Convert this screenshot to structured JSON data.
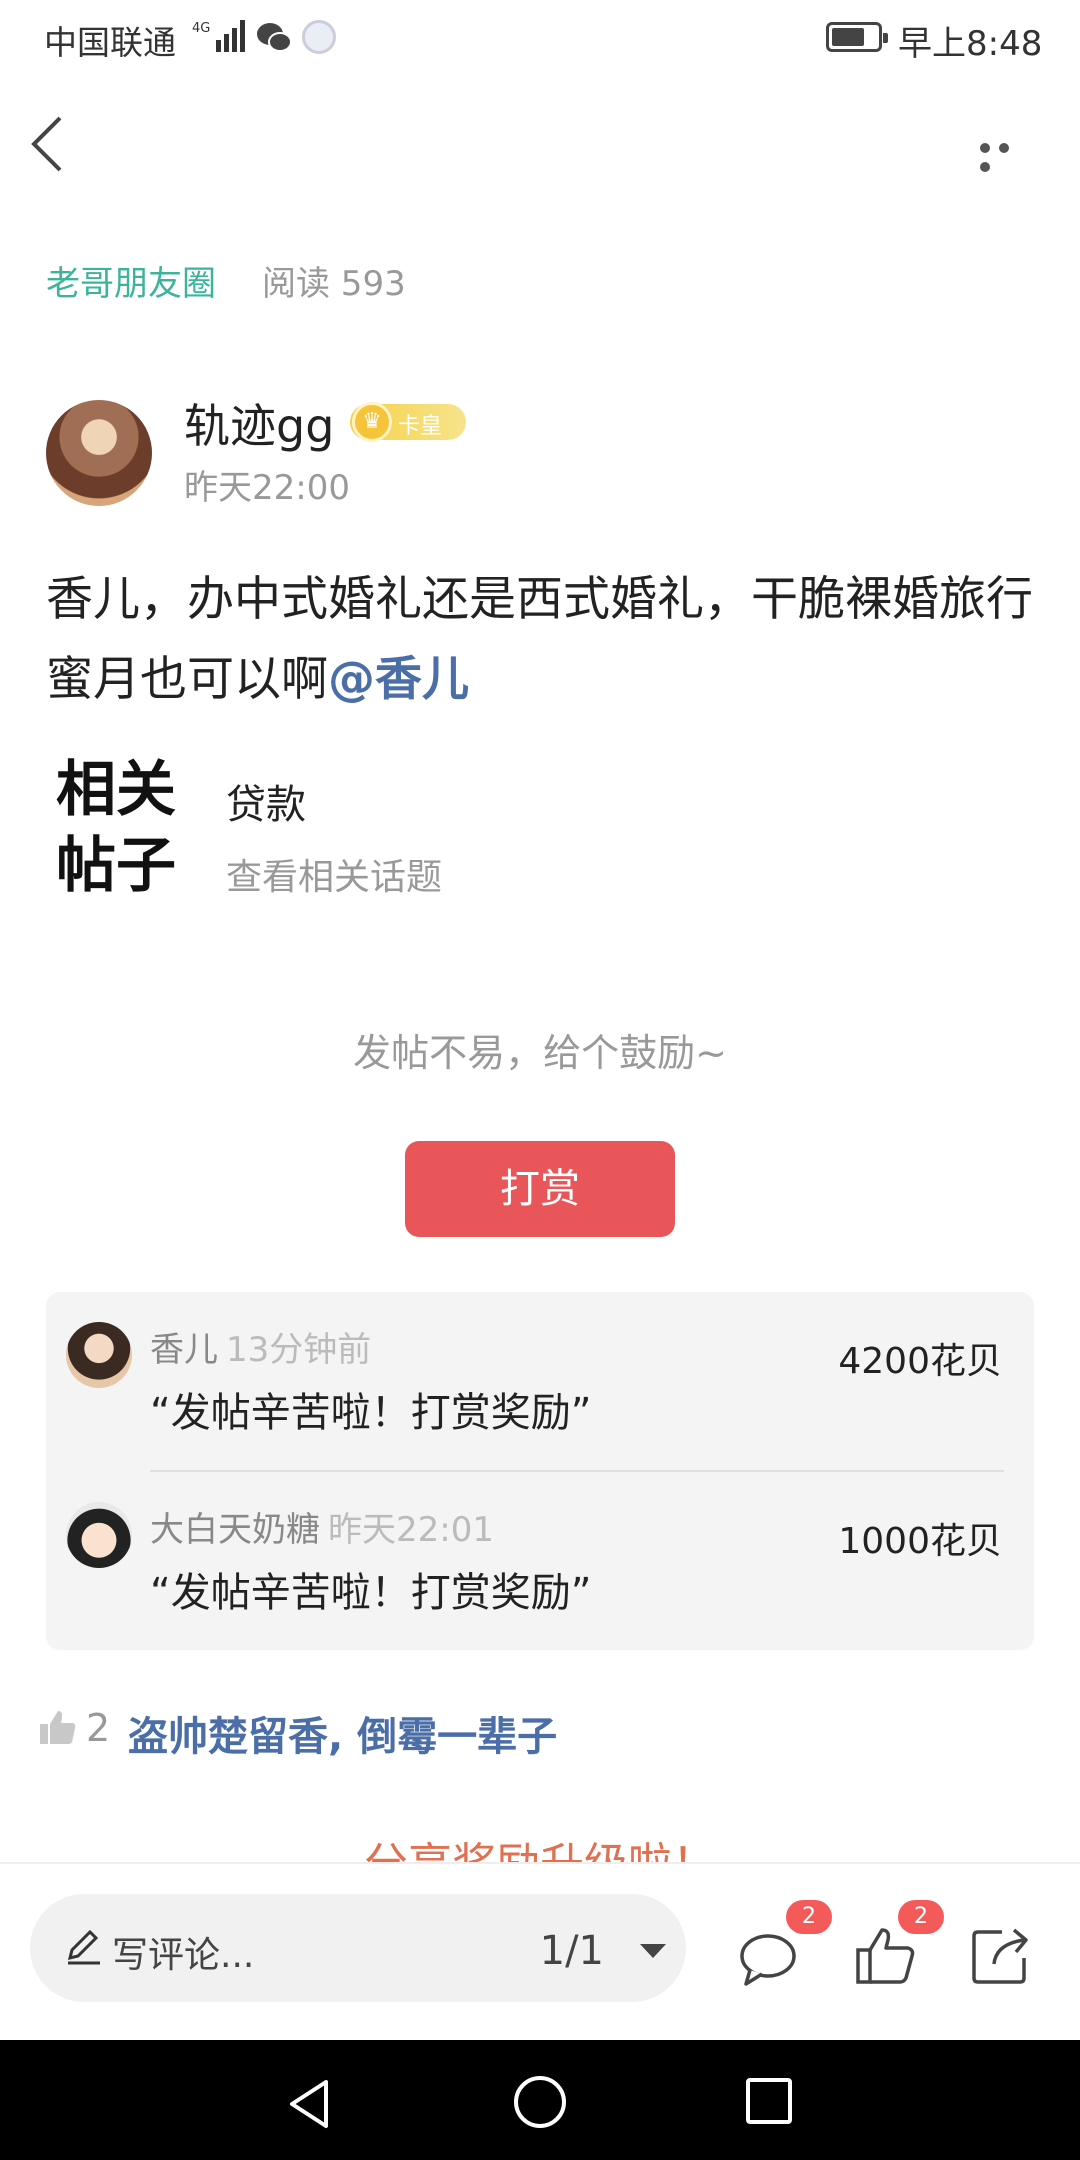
{
  "status_bar": {
    "carrier": "中国联通",
    "network": "4G",
    "time": "早上8:48"
  },
  "post": {
    "circle": "老哥朋友圈",
    "reads": "阅读 593",
    "author": "轨迹gg",
    "badge": "卡皇",
    "time": "昨天22:00",
    "content": "香儿，办中式婚礼还是西式婚礼，干脆裸婚旅行蜜月也可以啊",
    "mention": "@香儿"
  },
  "related": {
    "logo_line1": "相关",
    "logo_line2": "帖子",
    "tag": "贷款",
    "more": "查看相关话题"
  },
  "reward": {
    "encourage": "发帖不易，给个鼓励~",
    "button": "打赏",
    "list": [
      {
        "name": "香儿",
        "time": "13分钟前",
        "message": "“发帖辛苦啦！打赏奖励”",
        "amount": "4200花贝"
      },
      {
        "name": "大白天奶糖",
        "time": "昨天22:01",
        "message": "“发帖辛苦啦！打赏奖励”",
        "amount": "1000花贝"
      }
    ]
  },
  "likes": {
    "count": "2",
    "users": "盗帅楚留香, 倒霉一辈子"
  },
  "teaser": "分享奖励升级啦！",
  "bottom_bar": {
    "comment_placeholder": "写评论...",
    "page": "1/1",
    "comment_badge": "2",
    "like_badge": "2"
  },
  "colors": {
    "accent_green": "#3cb49c",
    "link_blue": "#4b6ea8",
    "reward_red": "#e9565a"
  }
}
